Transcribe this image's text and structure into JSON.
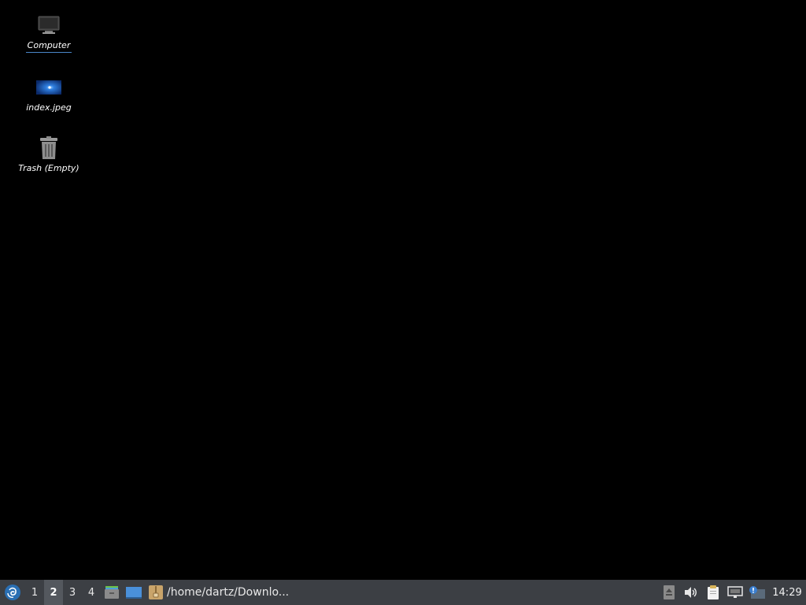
{
  "desktop": {
    "icons": [
      {
        "label": "Computer",
        "icon": "computer-icon"
      },
      {
        "label": "index.jpeg",
        "icon": "image-file-icon"
      },
      {
        "label": "Trash (Empty)",
        "icon": "trash-icon"
      }
    ]
  },
  "panel": {
    "menu_icon": "debian-swirl-menu-icon",
    "workspaces": [
      "1",
      "2",
      "3",
      "4"
    ],
    "active_workspace": "2",
    "launchers": [
      "file-manager-icon",
      "show-desktop-icon"
    ],
    "task": {
      "label": "/home/dartz/Downlo...",
      "icon": "archive-icon"
    },
    "tray": [
      "eject-icon",
      "volume-icon",
      "clipboard-icon",
      "network-icon",
      "update-notifier-icon"
    ],
    "clock": "14:29"
  },
  "colors": {
    "desktop_bg": "#000000",
    "panel_bg": "#3c3f44",
    "selection_underline": "#4a86c8"
  }
}
